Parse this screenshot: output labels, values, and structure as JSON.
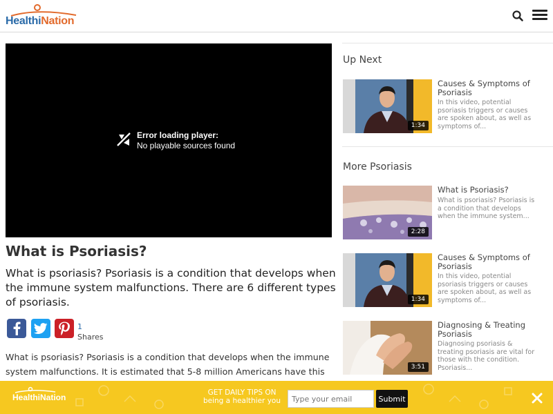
{
  "header": {
    "logo_part1": "Healthi",
    "logo_part2": "Nation",
    "search_icon": "search-icon",
    "menu_icon": "hamburger-menu-icon"
  },
  "player": {
    "error_title": "Error loading player:",
    "error_message": "No playable sources found",
    "icon": "broken-media-icon"
  },
  "article": {
    "title": "What is Psoriasis?",
    "summary": "What is psoriasis? Psoriasis is a condition that develops when the immune system malfunctions. There are 6 different types of psoriasis.",
    "body": "What is psoriasis? Psoriasis is a condition that develops when the immune system malfunctions. It is estimated that 5-8 million Americans have this chronic disease. As Dr. Robin Ruben explains in this video, psoriasis flares"
  },
  "share": {
    "count": "1",
    "label": "Shares",
    "colors": {
      "facebook": "#3b5998",
      "twitter": "#1da1f2",
      "pinterest": "#cb2027"
    }
  },
  "sidebar": {
    "up_next_title": "Up Next",
    "more_title": "More Psoriasis",
    "up_next": [
      {
        "title": "Causes & Symptoms of Psoriasis",
        "desc": "In this video, potential psoriasis triggers or causes are spoken about, as well as symptoms of...",
        "duration": "1:34"
      }
    ],
    "more": [
      {
        "title": "What is Psoriasis?",
        "desc": "What is psoriasis? Psoriasis is a condition that develops when the immune system...",
        "duration": "2:28"
      },
      {
        "title": "Causes & Symptoms of Psoriasis",
        "desc": "In this video, potential psoriasis triggers or causes are spoken about, as well as symptoms of...",
        "duration": "1:34"
      },
      {
        "title": "Diagnosing & Treating Psoriasis",
        "desc": "Diagnosing psoriasis & treating psoriasis are vital for those with the condition. Psoriasis...",
        "duration": "3:51"
      }
    ]
  },
  "banner": {
    "logo": "HealthiNation",
    "tagline_line1": "GET DAILY TIPS ON",
    "tagline_line2": "being a healthier you",
    "email_placeholder": "Type your email",
    "submit_label": "Submit",
    "background_color": "#f6c820",
    "close_icon": "close-icon"
  }
}
